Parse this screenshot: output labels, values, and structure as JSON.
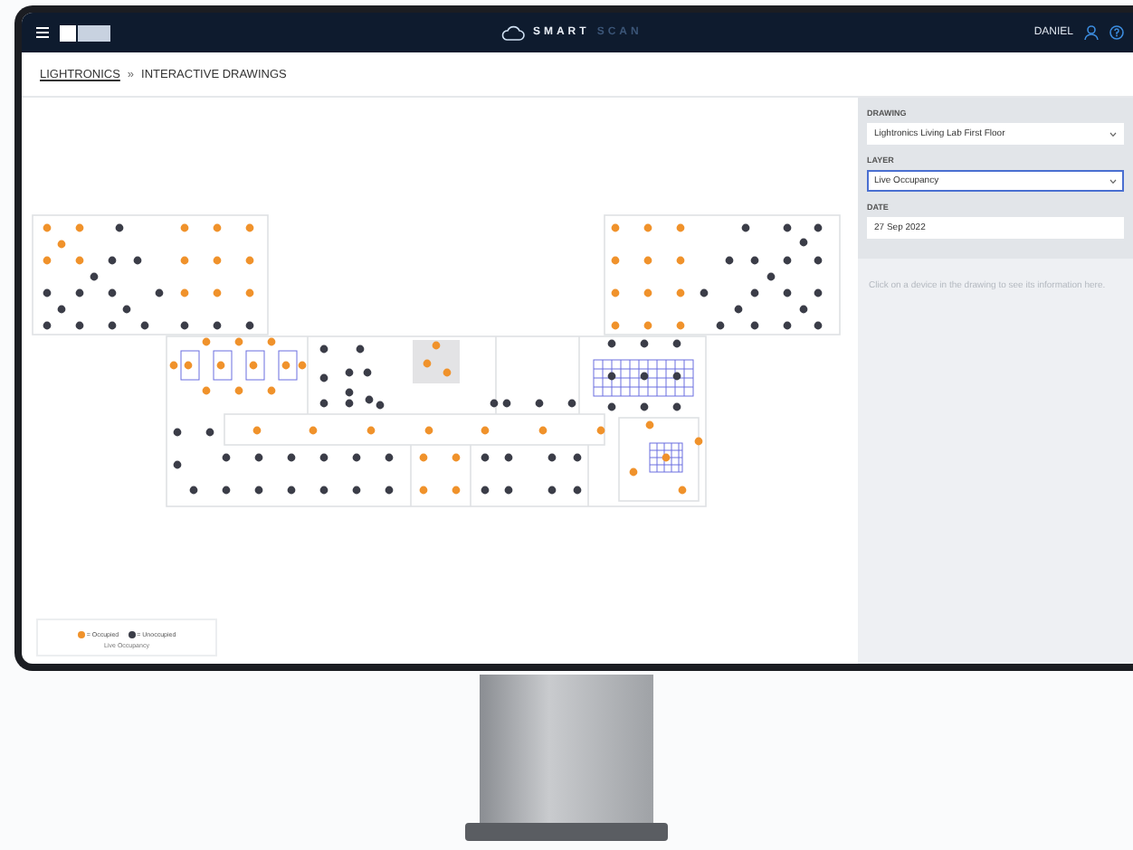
{
  "header": {
    "brand": [
      "SMART",
      "SCAN"
    ],
    "user": "DANIEL"
  },
  "breadcrumb": {
    "items": [
      {
        "label": "LIGHTRONICS",
        "link": true
      },
      {
        "label": "INTERACTIVE DRAWINGS",
        "link": false
      }
    ],
    "separator": "»"
  },
  "sidebar": {
    "fields": [
      {
        "label": "DRAWING",
        "value": "Lightronics Living Lab First Floor",
        "kind": "select",
        "focused": false
      },
      {
        "label": "LAYER",
        "value": "Live Occupancy",
        "kind": "select",
        "focused": true
      },
      {
        "label": "DATE",
        "value": "27 Sep 2022",
        "kind": "text",
        "focused": false
      }
    ],
    "info": "Click on a device in the drawing to see its information here."
  },
  "legend": {
    "items": [
      {
        "label": "= Occupied",
        "color": "#f0922b"
      },
      {
        "label": "= Unoccupied",
        "color": "#3b3d48"
      }
    ],
    "caption": "Live Occupancy"
  }
}
